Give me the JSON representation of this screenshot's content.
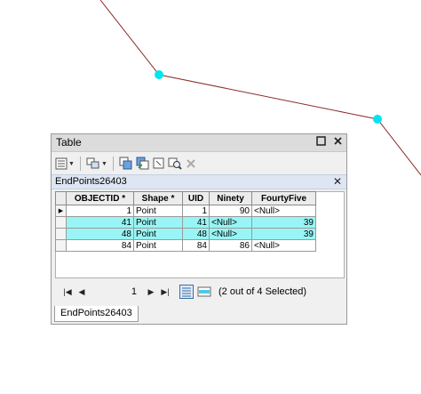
{
  "window": {
    "title": "Table",
    "table_tab": "EndPoints26403",
    "bottom_tab": "EndPoints26403"
  },
  "table": {
    "columns": [
      "OBJECTID *",
      "Shape *",
      "UID",
      "Ninety",
      "FourtyFive"
    ],
    "rows": [
      {
        "objectid": "1",
        "shape": "Point",
        "uid": "1",
        "ninety": "90",
        "fourtyfive": "<Null>",
        "selected": false,
        "current": true
      },
      {
        "objectid": "41",
        "shape": "Point",
        "uid": "41",
        "ninety": "<Null>",
        "fourtyfive": "39",
        "selected": true,
        "current": false
      },
      {
        "objectid": "48",
        "shape": "Point",
        "uid": "48",
        "ninety": "<Null>",
        "fourtyfive": "39",
        "selected": true,
        "current": false
      },
      {
        "objectid": "84",
        "shape": "Point",
        "uid": "84",
        "ninety": "86",
        "fourtyfive": "<Null>",
        "selected": false,
        "current": false
      }
    ]
  },
  "nav": {
    "record": "1",
    "status": "(2 out of 4 Selected)"
  },
  "colors": {
    "selection": "#99f5f5",
    "point": "#00e5ee",
    "line": "#8b2a2a"
  },
  "icons": [
    "table-options-icon",
    "related-tables-icon",
    "select-by-attributes-icon",
    "switch-selection-icon",
    "clear-selection-icon",
    "zoom-to-selected-icon",
    "delete-selected-icon",
    "first-record-icon",
    "previous-record-icon",
    "next-record-icon",
    "last-record-icon",
    "show-all-records-icon",
    "show-selected-records-icon"
  ]
}
